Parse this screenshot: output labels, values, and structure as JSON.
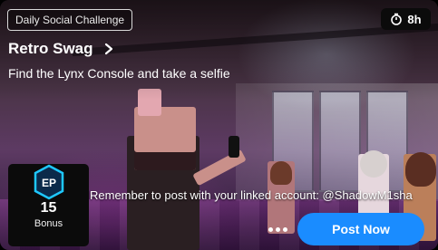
{
  "challenge": {
    "tag_label": "Daily Social Challenge",
    "timer_value": "8h",
    "title": "Retro Swag",
    "subtitle": "Find the Lynx Console and take a selfie"
  },
  "reward": {
    "badge_text": "EP",
    "value": "15",
    "label": "Bonus"
  },
  "reminder_text": "Remember to post with your linked account: @ShadowM1sha",
  "actions": {
    "post_label": "Post Now"
  },
  "icons": {
    "timer": "stopwatch-icon",
    "title_chevron": "chevron-right-icon",
    "more": "more-dots-icon",
    "ep_badge": "ep-hexagon-icon"
  },
  "colors": {
    "accent_blue": "#1a8cff",
    "badge_cyan": "#1ec8ff",
    "badge_dark": "#0b2a4a"
  }
}
